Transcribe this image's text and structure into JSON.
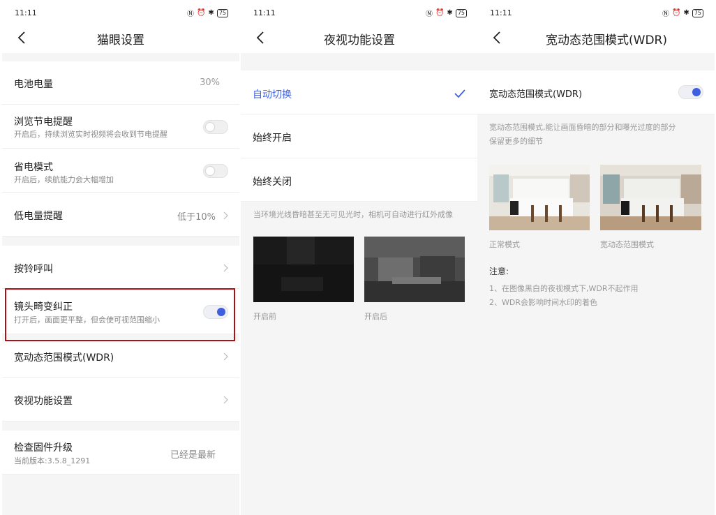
{
  "status": {
    "time": "11:11",
    "signal": "ᵢıll ᵢıll",
    "network": "HD",
    "battery": "75"
  },
  "screen1": {
    "title": "猫眼设置",
    "battery": {
      "label": "电池电量",
      "value": "30%"
    },
    "browse_save": {
      "label": "浏览节电提醒",
      "sub": "开启后，持续浏览实时视频将会收到节电提醒",
      "on": false
    },
    "power_save": {
      "label": "省电模式",
      "sub": "开启后，续航能力会大幅增加",
      "on": false
    },
    "low_battery": {
      "label": "低电量提醒",
      "value": "低于10%"
    },
    "doorbell_call": {
      "label": "按铃呼叫"
    },
    "lens_correction": {
      "label": "镜头畸变纠正",
      "sub": "打开后，画面更平整，但会使可视范围缩小",
      "on": true
    },
    "wdr": {
      "label": "宽动态范围模式(WDR)"
    },
    "night_vision": {
      "label": "夜视功能设置"
    },
    "firmware": {
      "label": "检查固件升级",
      "sub": "当前版本:3.5.8_1291",
      "value": "已经是最新"
    }
  },
  "screen2": {
    "title": "夜视功能设置",
    "options": [
      {
        "label": "自动切换",
        "selected": true
      },
      {
        "label": "始终开启",
        "selected": false
      },
      {
        "label": "始终关闭",
        "selected": false
      }
    ],
    "description": "当环境光线昏暗甚至无可见光时，相机可自动进行红外成像",
    "before_caption": "开启前",
    "after_caption": "开启后"
  },
  "screen3": {
    "title": "宽动态范围模式(WDR)",
    "toggle_label": "宽动态范围模式(WDR)",
    "toggle_on": true,
    "description_line1": "宽动态范围模式,能让画面昏暗的部分和曝光过度的部分",
    "description_line2": "保留更多的细节",
    "normal_caption": "正常模式",
    "wdr_caption": "宽动态范围模式",
    "note_title": "注意:",
    "note1": "1、在图像黑白的夜视模式下,WDR不起作用",
    "note2": "2、WDR会影响时间水印的着色"
  },
  "colors": {
    "accent": "#3d5fe0",
    "highlight": "#b00e12"
  }
}
